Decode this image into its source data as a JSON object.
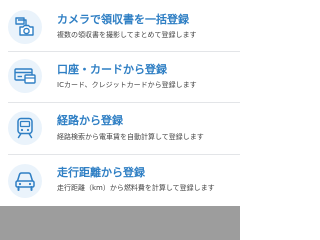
{
  "menu": {
    "items": [
      {
        "title": "カメラで領収書を一括登録",
        "description": "複数の領収書を撮影してまとめて登録します",
        "icon": "receipts-camera-icon"
      },
      {
        "title": "口座・カードから登録",
        "description": "ICカード、クレジットカードから登録します",
        "icon": "card-icon"
      },
      {
        "title": "経路から登録",
        "description": "経路検索から電車賃を自動計算して登録します",
        "icon": "train-icon"
      },
      {
        "title": "走行距離から登録",
        "description": "走行距離（km）から燃料費を計算して登録します",
        "icon": "car-icon"
      }
    ]
  },
  "colors": {
    "accent": "#2f7fc4",
    "icon_background": "#eaf3fb",
    "overlay": "#9d9d9d"
  }
}
